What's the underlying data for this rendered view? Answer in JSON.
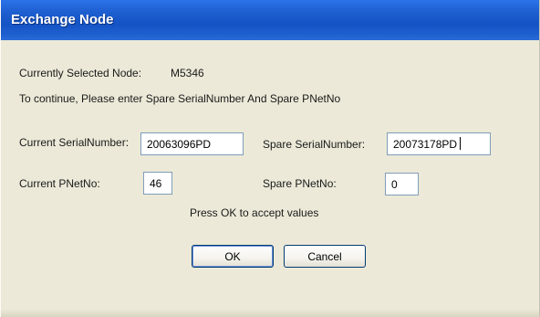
{
  "window": {
    "title": "Exchange Node"
  },
  "info": {
    "selected_label": "Currently Selected Node:",
    "selected_value": "M5346",
    "instruction": "To continue, Please enter Spare SerialNumber And Spare PNetNo"
  },
  "form": {
    "current_serial_label": "Current SerialNumber:",
    "current_serial_value": "20063096PD",
    "spare_serial_label": "Spare SerialNumber:",
    "spare_serial_value": "20073178PD",
    "current_pnet_label": "Current PNetNo:",
    "current_pnet_value": "46",
    "spare_pnet_label": "Spare PNetNo:",
    "spare_pnet_value": "0"
  },
  "hint": "Press OK to accept values",
  "buttons": {
    "ok": "OK",
    "cancel": "Cancel"
  },
  "colors": {
    "titlebar": "#1e5fd0",
    "dialog_bg": "#ece9d8",
    "field_border": "#7f9db9"
  }
}
